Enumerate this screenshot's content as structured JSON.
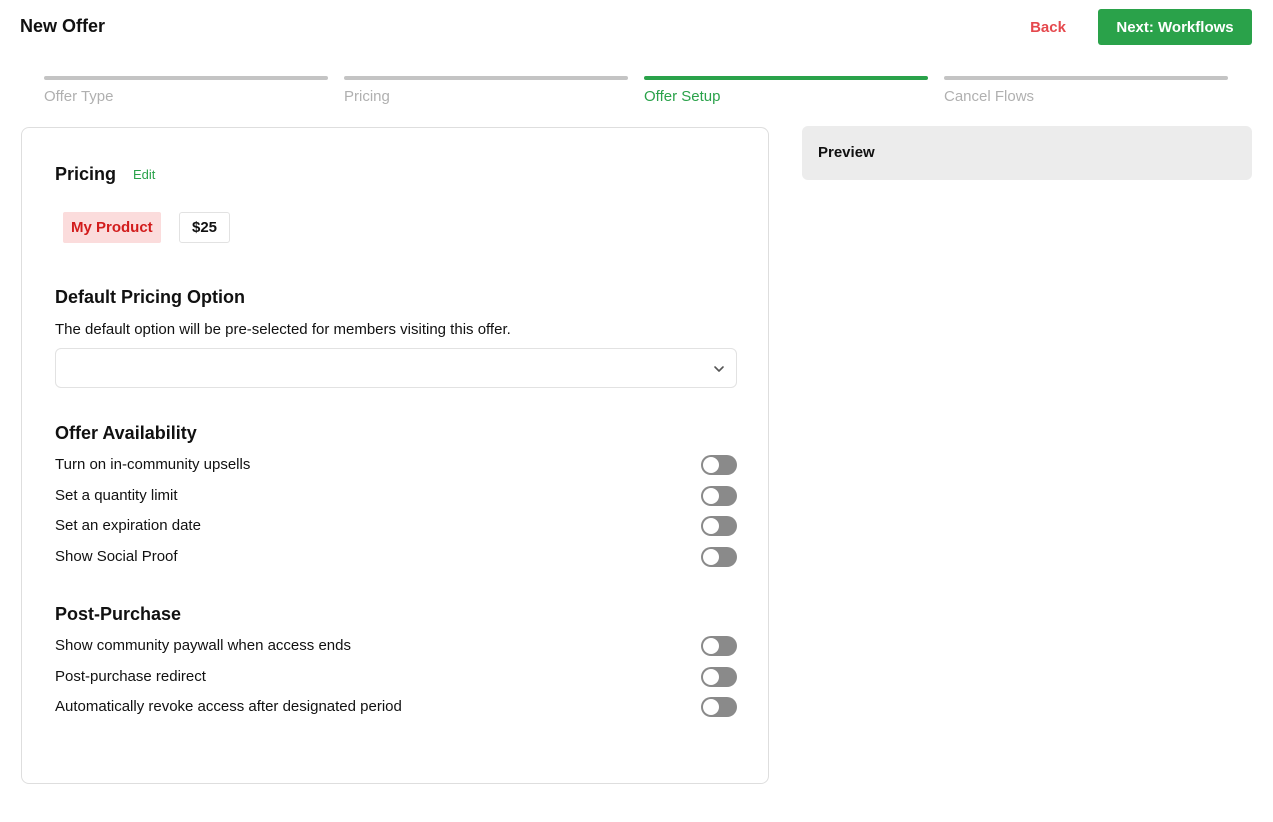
{
  "header": {
    "title": "New Offer",
    "back_label": "Back",
    "next_label": "Next: Workflows"
  },
  "steps": [
    {
      "label": "Offer Type",
      "active": false
    },
    {
      "label": "Pricing",
      "active": false
    },
    {
      "label": "Offer Setup",
      "active": true
    },
    {
      "label": "Cancel Flows",
      "active": false
    }
  ],
  "pricing": {
    "title": "Pricing",
    "edit_label": "Edit",
    "product_name": "My Product",
    "price": "$25"
  },
  "default_pricing": {
    "title": "Default Pricing Option",
    "description": "The default option will be pre-selected for members visiting this offer.",
    "selected_value": ""
  },
  "availability": {
    "title": "Offer Availability",
    "options": [
      {
        "label": "Turn on in-community upsells",
        "enabled": false
      },
      {
        "label": "Set a quantity limit",
        "enabled": false
      },
      {
        "label": "Set an expiration date",
        "enabled": false
      },
      {
        "label": "Show Social Proof",
        "enabled": false
      }
    ]
  },
  "post_purchase": {
    "title": "Post-Purchase",
    "options": [
      {
        "label": "Show community paywall when access ends",
        "enabled": false
      },
      {
        "label": "Post-purchase redirect",
        "enabled": false
      },
      {
        "label": "Automatically revoke access after designated period",
        "enabled": false
      }
    ]
  },
  "preview": {
    "title": "Preview"
  },
  "colors": {
    "accent_green": "#2aa24a",
    "back_red": "#e5484d",
    "tag_bg": "#fbdcdc",
    "tag_text": "#d21c1c",
    "toggle_off": "#8a8a8a"
  },
  "icons": {
    "select_chevron": "chevron-down-icon"
  }
}
